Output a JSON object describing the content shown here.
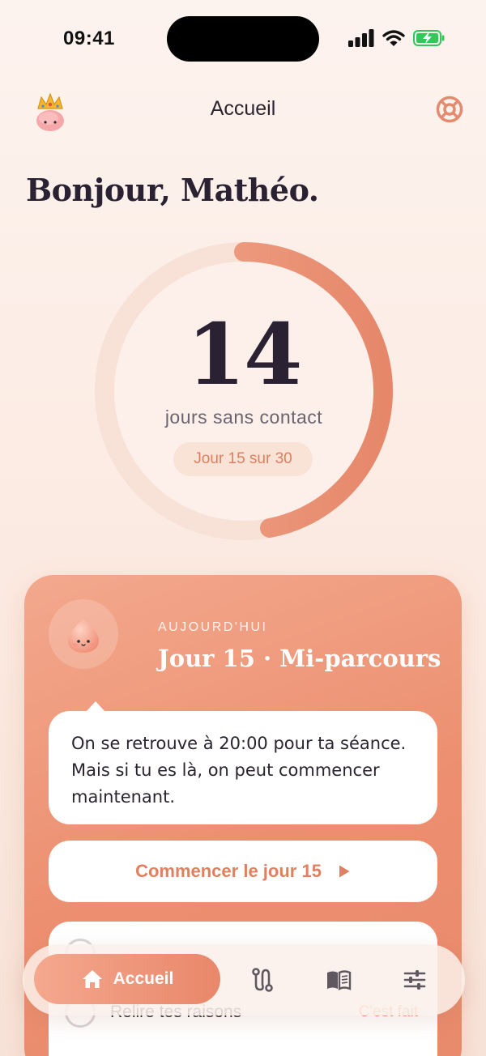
{
  "status_bar": {
    "time": "09:41"
  },
  "header": {
    "title": "Accueil"
  },
  "greeting": "Bonjour, Mathéo.",
  "streak": {
    "days": "14",
    "label": "jours sans contact",
    "pill": "Jour 15 sur 30",
    "progress": 0.47
  },
  "today_card": {
    "eyebrow": "AUJOURD'HUI",
    "title": "Jour 15 · Mi-parcours",
    "message": "On se retrouve à 20:00 pour ta séance. Mais si tu es là, on peut commencer maintenant.",
    "start_button": "Commencer le jour 15",
    "tasks": [
      {
        "label": "",
        "action": ""
      },
      {
        "label": "Relire tes raisons",
        "action": "C'est fait"
      }
    ]
  },
  "tabbar": {
    "active_label": "Accueil",
    "tabs": [
      "home-icon",
      "path-icon",
      "book-icon",
      "settings-sliders-icon"
    ]
  },
  "colors": {
    "accent": "#e9876a",
    "accent_light": "#f4a88e",
    "text": "#2a2233",
    "ring_track": "#f8e1d6"
  }
}
